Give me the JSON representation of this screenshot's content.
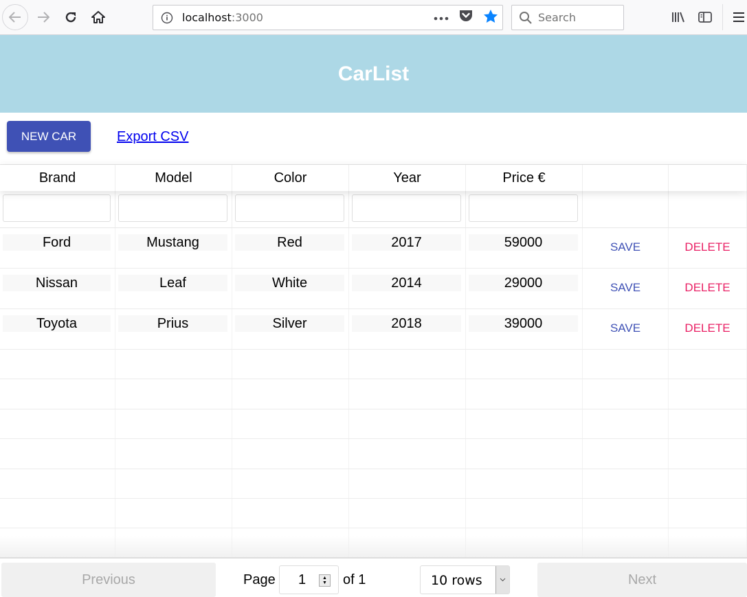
{
  "browser": {
    "url_host": "localhost",
    "url_port": ":3000",
    "search_placeholder": "Search",
    "icons": {
      "back": "arrow-left-icon",
      "forward": "arrow-right-icon",
      "reload": "reload-icon",
      "home": "home-icon",
      "info": "info-icon",
      "more": "more-dots-icon",
      "pocket": "pocket-icon",
      "bookmark": "star-icon",
      "search": "search-icon",
      "library": "library-icon",
      "sidebar": "sidebar-icon",
      "menu": "hamburger-menu-icon"
    },
    "accent_color": "#0a84ff"
  },
  "header": {
    "title": "CarList",
    "background": "#add8e6"
  },
  "toolbar": {
    "new_car_label": "NEW CAR",
    "export_label": "Export CSV",
    "primary_color": "#3f51b5"
  },
  "table": {
    "columns": [
      "Brand",
      "Model",
      "Color",
      "Year",
      "Price €",
      "",
      ""
    ],
    "rows": [
      {
        "brand": "Ford",
        "model": "Mustang",
        "color": "Red",
        "year": "2017",
        "price": "59000",
        "save": "SAVE",
        "delete": "DELETE"
      },
      {
        "brand": "Nissan",
        "model": "Leaf",
        "color": "White",
        "year": "2014",
        "price": "29000",
        "save": "SAVE",
        "delete": "DELETE"
      },
      {
        "brand": "Toyota",
        "model": "Prius",
        "color": "Silver",
        "year": "2018",
        "price": "39000",
        "save": "SAVE",
        "delete": "DELETE"
      }
    ],
    "empty_row_count": 7,
    "save_color": "#3f51b5",
    "delete_color": "#e91e63"
  },
  "pagination": {
    "previous_label": "Previous",
    "next_label": "Next",
    "page_label": "Page",
    "current_page": "1",
    "of_label": "of 1",
    "rows_option": "10 rows"
  }
}
